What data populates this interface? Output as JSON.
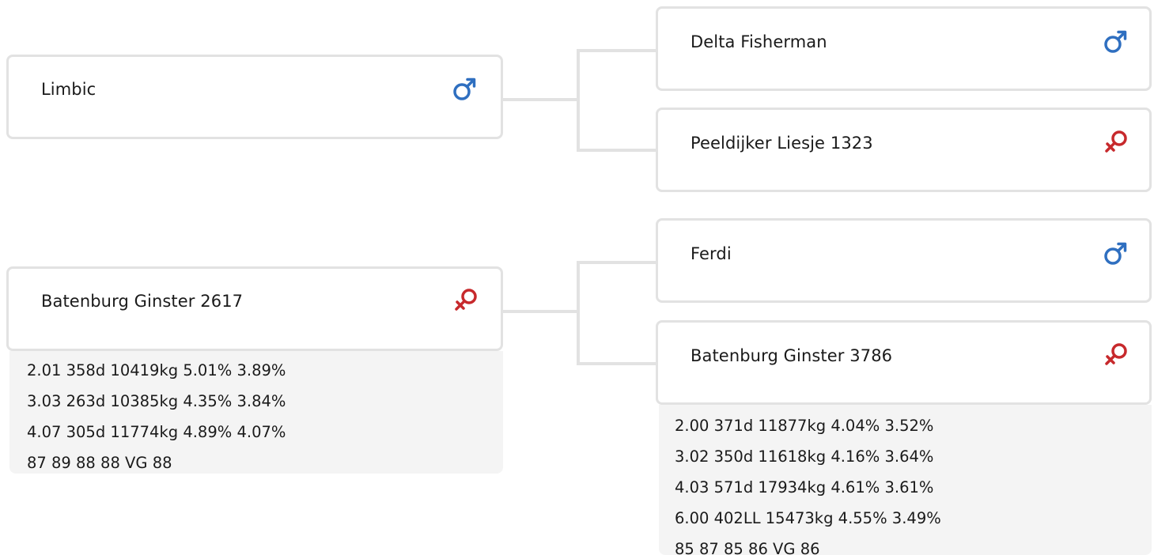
{
  "colors": {
    "male": "#2f6fc0",
    "female": "#c7292c",
    "border": "#e2e2e2",
    "performance_bg": "#f4f4f4"
  },
  "pedigree": {
    "sire": {
      "name": "Limbic",
      "sex": "male",
      "sex_icon": "male-icon",
      "sire": {
        "name": "Delta Fisherman",
        "sex": "male",
        "sex_icon": "male-icon"
      },
      "dam": {
        "name": "Peeldijker Liesje 1323",
        "sex": "female",
        "sex_icon": "female-icon"
      }
    },
    "dam": {
      "name": "Batenburg Ginster 2617",
      "sex": "female",
      "sex_icon": "female-icon",
      "performance": [
        "2.01 358d 10419kg 5.01% 3.89%",
        "3.03 263d 10385kg 4.35% 3.84%",
        "4.07 305d 11774kg 4.89% 4.07%",
        "87 89 88 88 VG 88"
      ],
      "sire": {
        "name": "Ferdi",
        "sex": "male",
        "sex_icon": "male-icon"
      },
      "dam": {
        "name": "Batenburg Ginster 3786",
        "sex": "female",
        "sex_icon": "female-icon",
        "performance": [
          "2.00 371d 11877kg 4.04% 3.52%",
          "3.02 350d 11618kg 4.16% 3.64%",
          "4.03 571d 17934kg 4.61% 3.61%",
          "6.00 402LL 15473kg 4.55% 3.49%",
          "85 87 85 86 VG 86"
        ]
      }
    }
  }
}
